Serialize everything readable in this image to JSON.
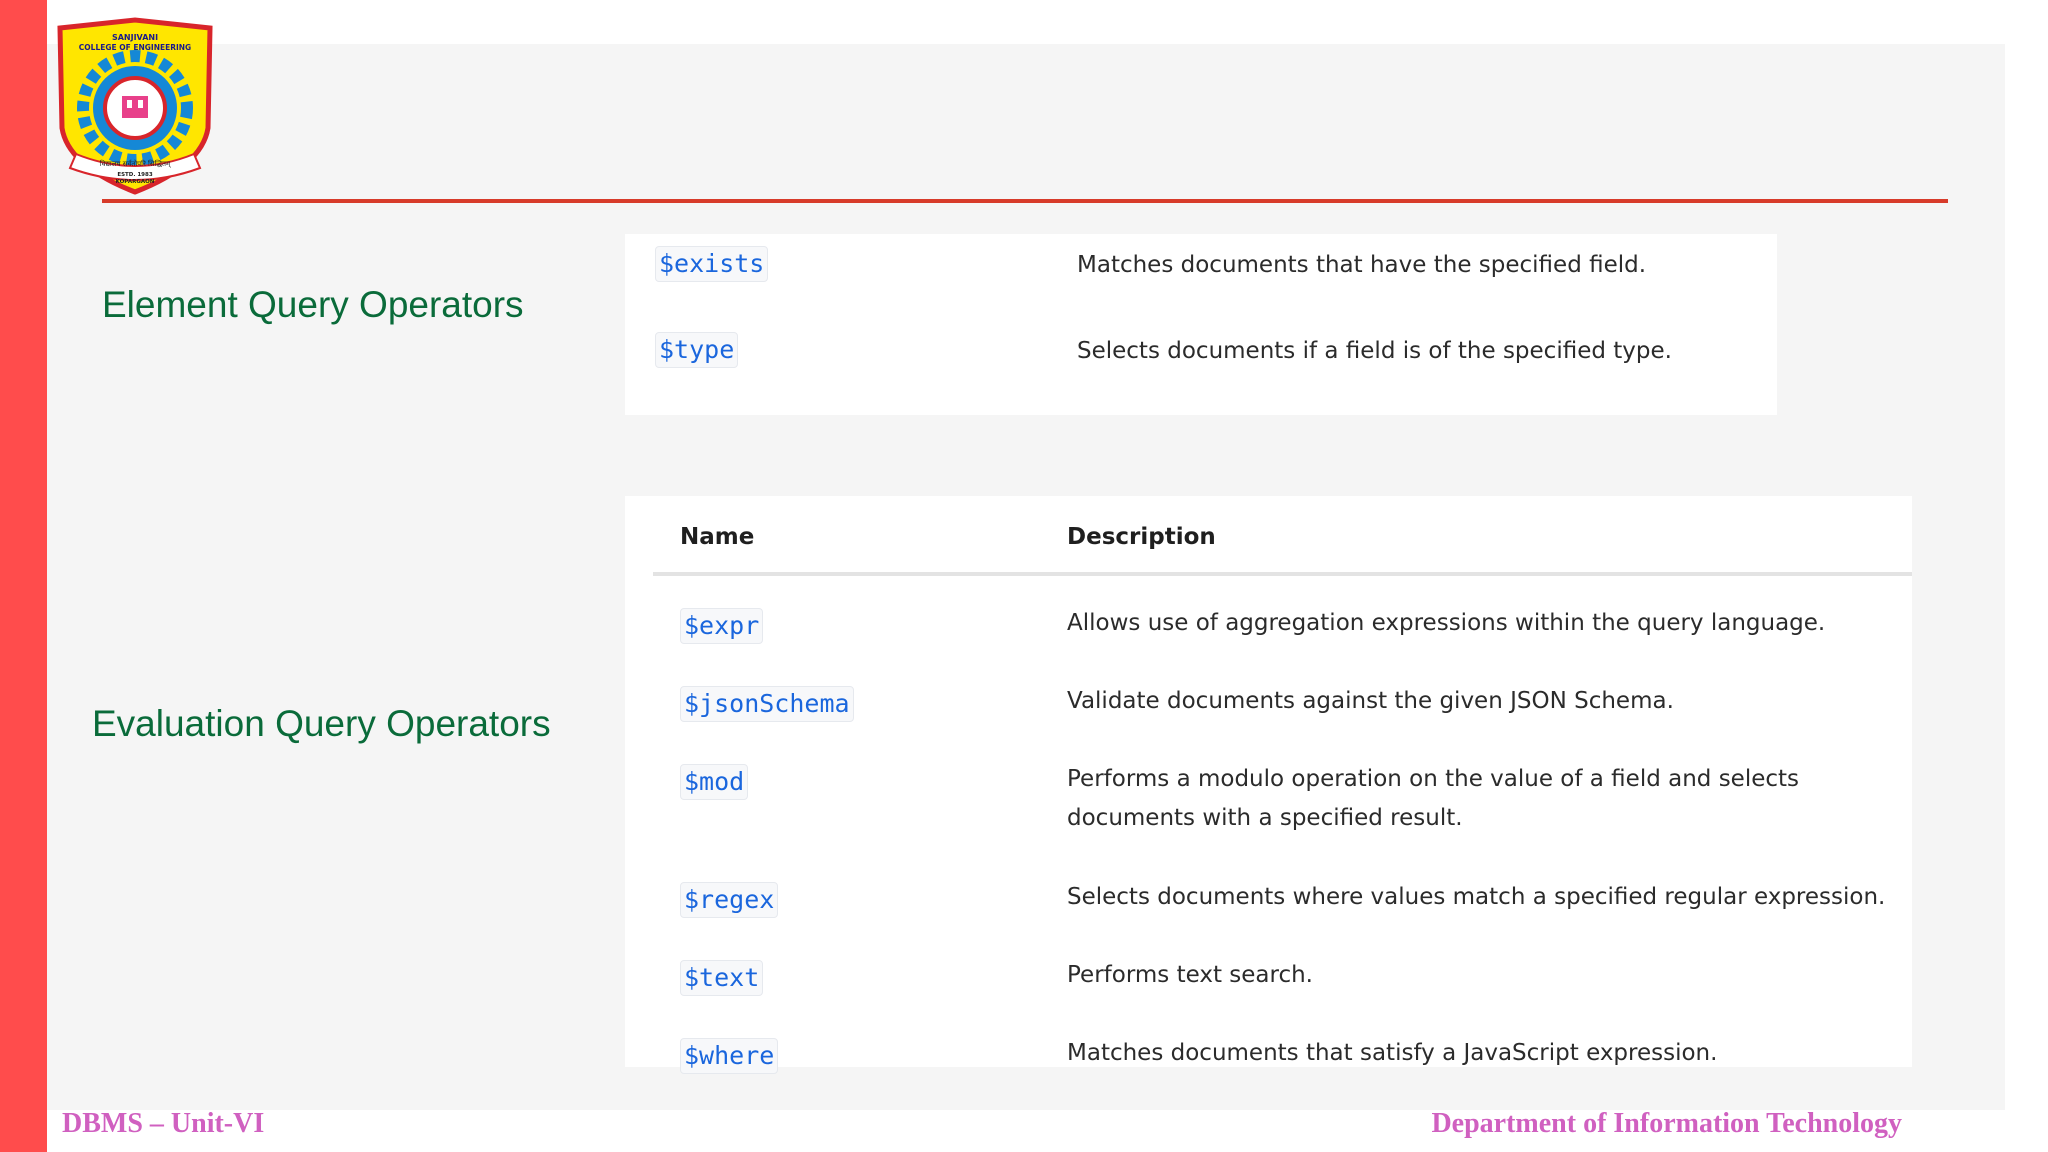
{
  "logo": {
    "line1": "SANJIVANI",
    "line2": "COLLEGE OF ENGINEERING",
    "motto": "विद्यालय सर्वतोपरि सिद्धितम्",
    "estd": "ESTD. 1983",
    "place": "KOPARGAON"
  },
  "element_section": {
    "label": "Element Query Operators",
    "rows": [
      {
        "name": "$exists",
        "description": "Matches documents that have the specified field."
      },
      {
        "name": "$type",
        "description": "Selects documents if a field is of the specified type."
      }
    ]
  },
  "evaluation_section": {
    "label": "Evaluation Query Operators",
    "headers": {
      "name": "Name",
      "description": "Description"
    },
    "rows": [
      {
        "name": "$expr",
        "description": "Allows use of aggregation expressions within the query language."
      },
      {
        "name": "$jsonSchema",
        "description": "Validate documents against the given JSON Schema."
      },
      {
        "name": "$mod",
        "description": "Performs a modulo operation on the value of a field and selects",
        "description_line2": "documents with a specified result."
      },
      {
        "name": "$regex",
        "description": "Selects documents where values match a specified regular expression."
      },
      {
        "name": "$text",
        "description": "Performs text search."
      },
      {
        "name": "$where",
        "description": "Matches documents that satisfy a JavaScript expression."
      }
    ]
  },
  "footer": {
    "left": "DBMS – Unit-VI",
    "right": "Department of Information Technology"
  },
  "colors": {
    "accent_bar": "#ff4c4c",
    "rule": "#d73b2a",
    "section_label": "#0a6b3a",
    "operator": "#1a66dd",
    "footer": "#d060c0"
  }
}
